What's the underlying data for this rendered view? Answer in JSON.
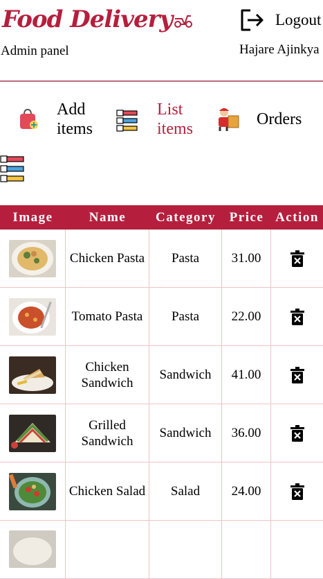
{
  "header": {
    "brand": "Food Delivery",
    "subtitle": "Admin panel",
    "logout_label": "Logout",
    "username": "Hajare Ajinkya"
  },
  "nav": [
    {
      "line1": "Add",
      "line2": "items",
      "icon": "shopping-bag-add-icon"
    },
    {
      "line1": "List",
      "line2": "items",
      "icon": "numbered-list-icon"
    },
    {
      "line1": "Orders",
      "line2": "",
      "icon": "delivery-person-icon"
    }
  ],
  "colors": {
    "accent": "#b51f3d",
    "border": "#f0c3c3"
  },
  "table": {
    "headers": [
      "Image",
      "Name",
      "Category",
      "Price",
      "Action"
    ],
    "rows": [
      {
        "name": "Chicken Pasta",
        "category": "Pasta",
        "price": "31.00"
      },
      {
        "name": "Tomato Pasta",
        "category": "Pasta",
        "price": "22.00"
      },
      {
        "name": "Chicken Sandwich",
        "category": "Sandwich",
        "price": "41.00"
      },
      {
        "name": "Grilled Sandwich",
        "category": "Sandwich",
        "price": "36.00"
      },
      {
        "name": "Chicken Salad",
        "category": "Salad",
        "price": "24.00"
      }
    ]
  }
}
